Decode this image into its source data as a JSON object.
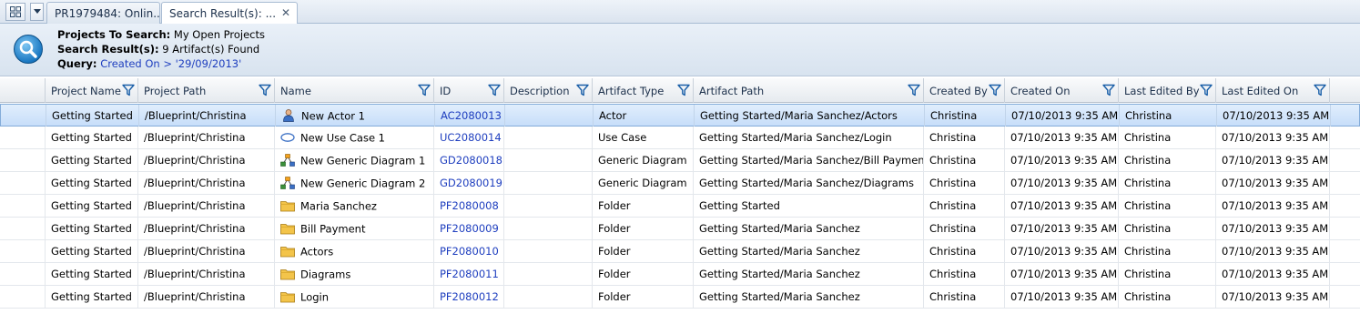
{
  "tabs": [
    {
      "label": "PR1979484: Onlin...",
      "active": false
    },
    {
      "label": "Search Result(s): ...",
      "active": true
    }
  ],
  "header": {
    "projects_label": "Projects To Search:",
    "projects_value": "My Open Projects",
    "results_label": "Search Result(s):",
    "results_value": "9 Artifact(s) Found",
    "query_label": "Query:",
    "query_value": "Created On > '29/09/2013'"
  },
  "columns": [
    "Project Name",
    "Project Path",
    "Name",
    "ID",
    "Description",
    "Artifact Type",
    "Artifact Path",
    "Created By",
    "Created On",
    "Last Edited By",
    "Last Edited On"
  ],
  "rows": [
    {
      "project": "Getting Started",
      "path": "/Blueprint/Christina",
      "icon": "actor-icon",
      "name": "New Actor 1",
      "id": "AC2080013",
      "description": "",
      "type": "Actor",
      "artifact_path": "Getting Started/Maria Sanchez/Actors",
      "created_by": "Christina",
      "created_on": "07/10/2013 9:35 AM",
      "edited_by": "Christina",
      "edited_on": "07/10/2013 9:35 AM"
    },
    {
      "project": "Getting Started",
      "path": "/Blueprint/Christina",
      "icon": "use-case-icon",
      "name": "New Use Case 1",
      "id": "UC2080014",
      "description": "",
      "type": "Use Case",
      "artifact_path": "Getting Started/Maria Sanchez/Login",
      "created_by": "Christina",
      "created_on": "07/10/2013 9:35 AM",
      "edited_by": "Christina",
      "edited_on": "07/10/2013 9:35 AM"
    },
    {
      "project": "Getting Started",
      "path": "/Blueprint/Christina",
      "icon": "generic-diagram-icon",
      "name": "New Generic Diagram 1",
      "id": "GD2080018",
      "description": "",
      "type": "Generic Diagram",
      "artifact_path": "Getting Started/Maria Sanchez/Bill Payment",
      "created_by": "Christina",
      "created_on": "07/10/2013 9:35 AM",
      "edited_by": "Christina",
      "edited_on": "07/10/2013 9:35 AM"
    },
    {
      "project": "Getting Started",
      "path": "/Blueprint/Christina",
      "icon": "generic-diagram-icon",
      "name": "New Generic Diagram 2",
      "id": "GD2080019",
      "description": "",
      "type": "Generic Diagram",
      "artifact_path": "Getting Started/Maria Sanchez/Diagrams",
      "created_by": "Christina",
      "created_on": "07/10/2013 9:35 AM",
      "edited_by": "Christina",
      "edited_on": "07/10/2013 9:35 AM"
    },
    {
      "project": "Getting Started",
      "path": "/Blueprint/Christina",
      "icon": "folder-icon",
      "name": "Maria Sanchez",
      "id": "PF2080008",
      "description": "",
      "type": "Folder",
      "artifact_path": "Getting Started",
      "created_by": "Christina",
      "created_on": "07/10/2013 9:35 AM",
      "edited_by": "Christina",
      "edited_on": "07/10/2013 9:35 AM"
    },
    {
      "project": "Getting Started",
      "path": "/Blueprint/Christina",
      "icon": "folder-icon",
      "name": "Bill Payment",
      "id": "PF2080009",
      "description": "",
      "type": "Folder",
      "artifact_path": "Getting Started/Maria Sanchez",
      "created_by": "Christina",
      "created_on": "07/10/2013 9:35 AM",
      "edited_by": "Christina",
      "edited_on": "07/10/2013 9:35 AM"
    },
    {
      "project": "Getting Started",
      "path": "/Blueprint/Christina",
      "icon": "folder-icon",
      "name": "Actors",
      "id": "PF2080010",
      "description": "",
      "type": "Folder",
      "artifact_path": "Getting Started/Maria Sanchez",
      "created_by": "Christina",
      "created_on": "07/10/2013 9:35 AM",
      "edited_by": "Christina",
      "edited_on": "07/10/2013 9:35 AM"
    },
    {
      "project": "Getting Started",
      "path": "/Blueprint/Christina",
      "icon": "folder-icon",
      "name": "Diagrams",
      "id": "PF2080011",
      "description": "",
      "type": "Folder",
      "artifact_path": "Getting Started/Maria Sanchez",
      "created_by": "Christina",
      "created_on": "07/10/2013 9:35 AM",
      "edited_by": "Christina",
      "edited_on": "07/10/2013 9:35 AM"
    },
    {
      "project": "Getting Started",
      "path": "/Blueprint/Christina",
      "icon": "folder-icon",
      "name": "Login",
      "id": "PF2080012",
      "description": "",
      "type": "Folder",
      "artifact_path": "Getting Started/Maria Sanchez",
      "created_by": "Christina",
      "created_on": "07/10/2013 9:35 AM",
      "edited_by": "Christina",
      "edited_on": "07/10/2013 9:35 AM"
    }
  ],
  "selected_row": 0,
  "colors": {
    "link": "#1f3fbf",
    "selection": "#c7defa",
    "filter": "#1a5fa8"
  }
}
